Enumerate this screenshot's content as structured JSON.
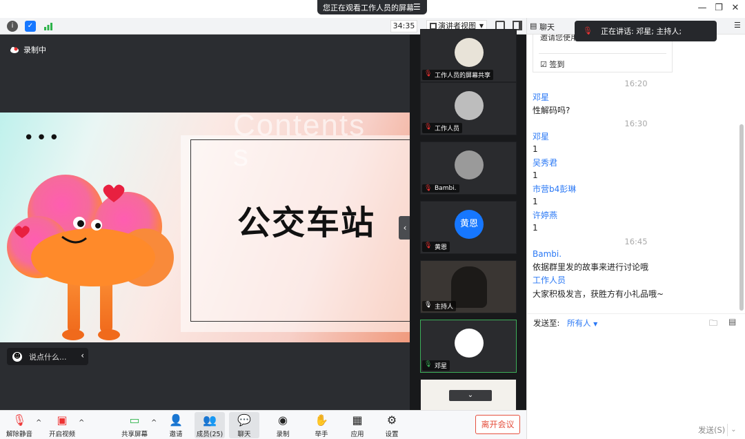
{
  "banner": {
    "sharing_text": "您正在观看工作人员的屏幕"
  },
  "toolbar": {
    "timer": "34:35",
    "view_label": "演讲者视图"
  },
  "stage": {
    "recording_label": "录制中",
    "slide_title": "公交车站",
    "slide_watermark": "Contents",
    "chat_placeholder": "说点什么..."
  },
  "participants": [
    {
      "name": "工作人员的屏幕共享",
      "muted": true
    },
    {
      "name": "工作人员",
      "muted": true
    },
    {
      "name": "Bambi.",
      "muted": true
    },
    {
      "name": "黄恩",
      "muted": true,
      "avatar_text": "黄恩",
      "avatar_color": "#1677ff"
    },
    {
      "name": "主持人",
      "muted": false
    },
    {
      "name": "邓星",
      "muted": false,
      "active": true
    }
  ],
  "bottombar": {
    "unmute": "解除静音",
    "video": "开启视频",
    "share": "共享屏幕",
    "invite": "邀请",
    "members": "成员(25)",
    "chat": "聊天",
    "record": "录制",
    "raise_hand": "举手",
    "apps": "应用",
    "settings": "设置",
    "leave": "离开会议"
  },
  "chat": {
    "title": "聊天",
    "speaking": "正在讲话: 邓星; 主持人;",
    "invite_text": "邀请您使用",
    "sign_in": "签到",
    "messages": [
      {
        "type": "time",
        "text": "16:20"
      },
      {
        "type": "msg",
        "sender": "邓星",
        "text": "性解码吗?"
      },
      {
        "type": "time",
        "text": "16:30"
      },
      {
        "type": "msg",
        "sender": "邓星",
        "text": "1"
      },
      {
        "type": "msg",
        "sender": "吴秀君",
        "text": "1"
      },
      {
        "type": "msg",
        "sender": "市营b4彭琳",
        "text": "1"
      },
      {
        "type": "msg",
        "sender": "许婷燕",
        "text": "1"
      },
      {
        "type": "time",
        "text": "16:45"
      },
      {
        "type": "msg",
        "sender": "Bambi.",
        "text": "依据群里发的故事来进行讨论哦"
      },
      {
        "type": "msg",
        "sender": "工作人员",
        "text": "大家积极发言，获胜方有小礼品哦~"
      }
    ],
    "send_to_label": "发送至:",
    "send_to_value": "所有人",
    "send_button": "发送(S)"
  },
  "colors": {
    "accent": "#2a78f5",
    "danger": "#e5503e",
    "active_border": "#3db05a"
  }
}
